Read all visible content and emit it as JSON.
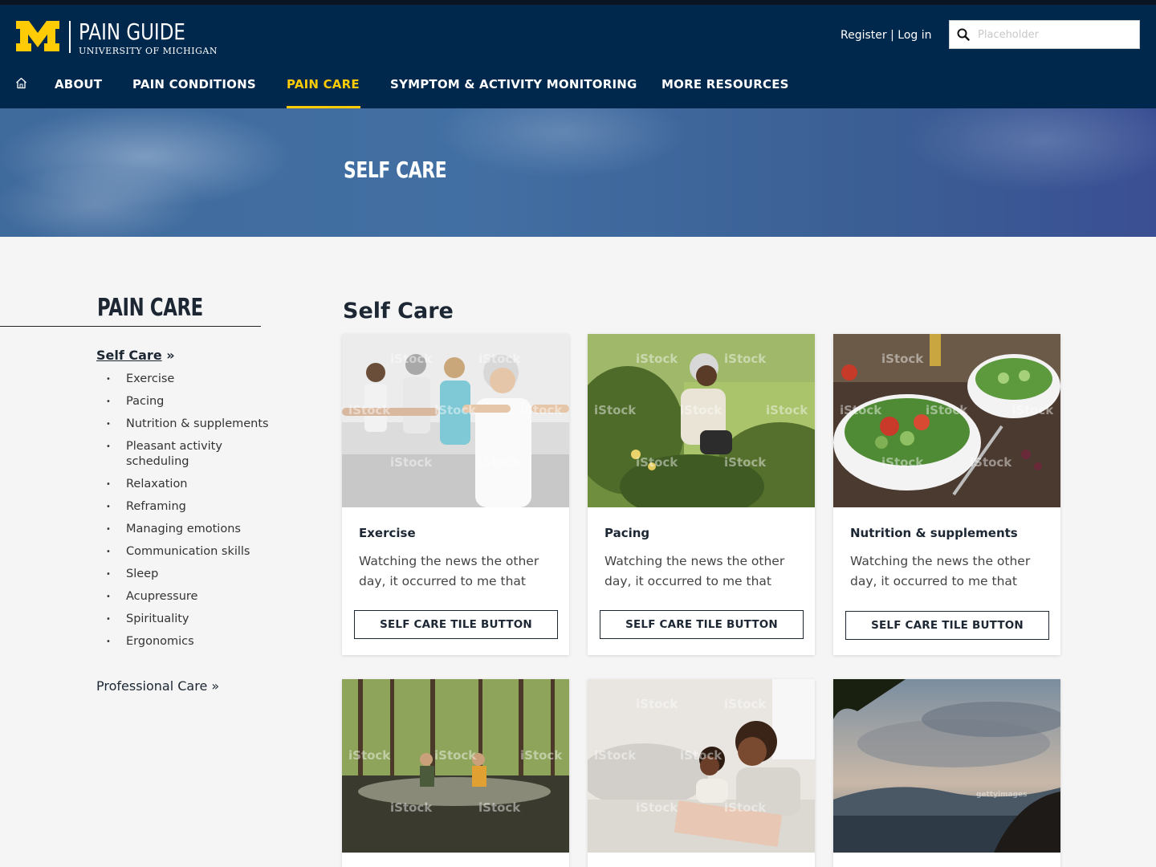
{
  "header": {
    "logo_title": "PAIN GUIDE",
    "logo_subtitle": "UNIVERSITY OF MICHIGAN",
    "register_label": "Register",
    "auth_separator": "|",
    "login_label": "Log in",
    "search_placeholder": "Placeholder"
  },
  "nav": {
    "items": [
      {
        "label": "ABOUT"
      },
      {
        "label": "PAIN CONDITIONS"
      },
      {
        "label": "PAIN CARE",
        "active": true
      },
      {
        "label": "SYMPTOM & ACTIVITY MONITORING"
      },
      {
        "label": "MORE RESOURCES"
      }
    ]
  },
  "hero": {
    "title": "SELF CARE"
  },
  "sidebar": {
    "title": "PAIN CARE",
    "current_section": "Self Care",
    "section_arrow": "»",
    "items": [
      "Exercise",
      "Pacing",
      "Nutrition & supplements",
      "Pleasant activity scheduling",
      "Relaxation",
      "Reframing",
      "Managing emotions",
      "Communication skills",
      "Sleep",
      "Acupressure",
      "Spirituality",
      "Ergonomics"
    ],
    "other_section": "Professional Care »"
  },
  "main": {
    "title": "Self Care",
    "cards": [
      {
        "title": "Exercise",
        "text": "Watching the news the other day, it occurred to me that",
        "button": "SELF CARE TILE BUTTON"
      },
      {
        "title": "Pacing",
        "text": "Watching the news the other day, it occurred to me that",
        "button": "SELF CARE TILE BUTTON"
      },
      {
        "title": "Nutrition & supplements",
        "text": "Watching the news the other day, it occurred to me that",
        "button": "SELF CARE TILE BUTTON"
      }
    ],
    "watermark": "iStock",
    "watermark_getty": "gettyimages"
  },
  "colors": {
    "brand_blue": "#00274c",
    "maize": "#ffcb05"
  }
}
